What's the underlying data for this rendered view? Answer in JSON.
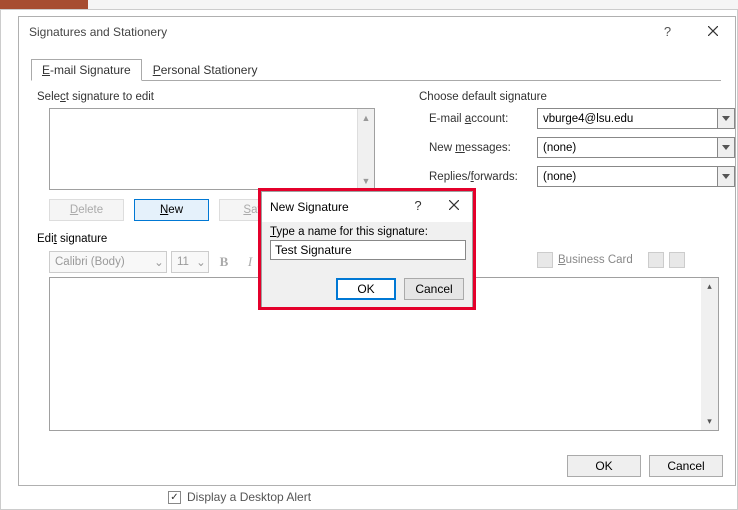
{
  "main_dialog": {
    "title": "Signatures and Stationery",
    "help": "?",
    "tabs": {
      "signature": "E-mail Signature",
      "stationery": "Personal Stationery"
    },
    "select_label": "Select signature to edit",
    "choose_label": "Choose default signature",
    "fields": {
      "email_label": "E-mail account:",
      "email_value": "vburge4@lsu.edu",
      "new_label": "New messages:",
      "new_value": "(none)",
      "replies_label": "Replies/forwards:",
      "replies_value": "(none)"
    },
    "buttons": {
      "delete": "Delete",
      "new": "New",
      "save": "Save"
    },
    "edit_label": "Edit signature",
    "toolbar": {
      "font": "Calibri (Body)",
      "size": "11",
      "business_card": "Business Card"
    },
    "footer": {
      "ok": "OK",
      "cancel": "Cancel"
    }
  },
  "sub_dialog": {
    "title": "New Signature",
    "help": "?",
    "prompt": "Type a name for this signature:",
    "value": "Test Signature",
    "ok": "OK",
    "cancel": "Cancel"
  },
  "desktop_alert": "Display a Desktop Alert"
}
